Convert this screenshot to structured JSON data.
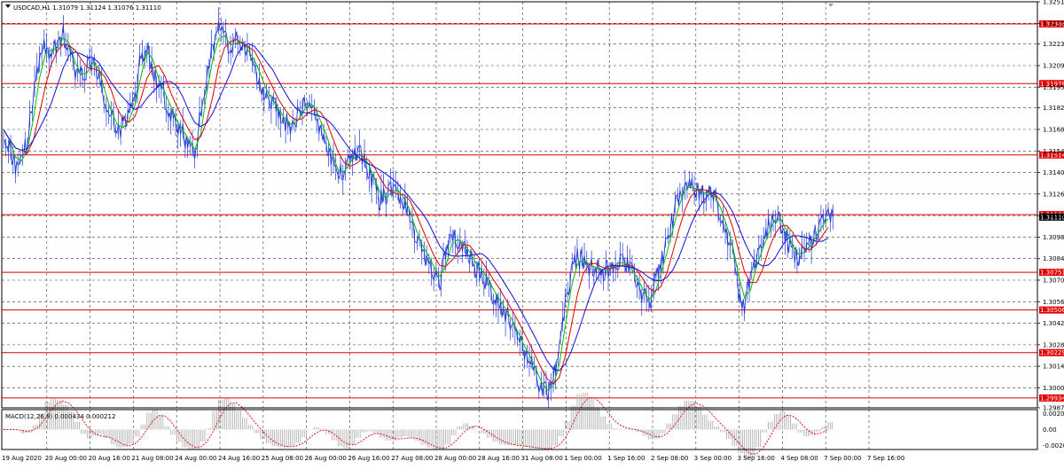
{
  "header": {
    "symbol_info": "USDCAD,H1  1.31079 1.31124 1.31076 1.31110"
  },
  "macd": {
    "label": "MACD(12,26,9) 0.000434 0.000212",
    "y_ticks": [
      "0.002087",
      "0.00",
      "-0.002052"
    ],
    "ylim": [
      -0.0026,
      0.0026
    ]
  },
  "colors": {
    "background": "#ffffff",
    "price_line": "#1f39d8",
    "ma_fast": "#00c000",
    "ma_mid": "#e00000",
    "ma_slow": "#1010e0",
    "level_line": "#e00000",
    "macd_hist": "#b0b0b0",
    "macd_signal": "#e00000"
  },
  "chart_data": {
    "type": "line",
    "ylim": [
      1.2987,
      1.3251
    ],
    "grid": true,
    "y_ticks": [
      "1.32510",
      "1.32370",
      "1.32235",
      "1.32095",
      "1.31955",
      "1.31820",
      "1.31680",
      "1.31540",
      "1.31400",
      "1.31260",
      "1.31120",
      "1.30980",
      "1.30840",
      "1.30700",
      "1.30560",
      "1.30420",
      "1.30280",
      "1.30140",
      "1.30000",
      "1.29870"
    ],
    "x_ticks": [
      "19 Aug 2020",
      "20 Aug 00:00",
      "20 Aug 16:00",
      "21 Aug 08:00",
      "24 Aug 00:00",
      "24 Aug 16:00",
      "25 Aug 08:00",
      "26 Aug 00:00",
      "26 Aug 16:00",
      "27 Aug 08:00",
      "28 Aug 00:00",
      "28 Aug 16:00",
      "31 Aug 08:00",
      "1 Sep 00:00",
      "1 Sep 16:00",
      "2 Sep 08:00",
      "3 Sep 00:00",
      "3 Sep 16:00",
      "4 Sep 08:00",
      "7 Sep 00:00",
      "7 Sep 16:00"
    ],
    "levels": [
      "1.32366",
      "1.31978",
      "1.31514",
      "1.31126",
      "1.30751",
      "1.30506",
      "1.30229",
      "1.29934"
    ],
    "current_price": "1.31110",
    "series": [
      {
        "values": [
          1.3168,
          1.3155,
          1.3145,
          1.315,
          1.316,
          1.319,
          1.3212,
          1.3222,
          1.3217,
          1.3225,
          1.323,
          1.3218,
          1.3205,
          1.3202,
          1.3208,
          1.3215,
          1.32,
          1.3185,
          1.3175,
          1.3168,
          1.317,
          1.3178,
          1.319,
          1.3215,
          1.3222,
          1.3205,
          1.3196,
          1.3188,
          1.3178,
          1.317,
          1.3165,
          1.3158,
          1.3152,
          1.3178,
          1.3205,
          1.3222,
          1.3232,
          1.3226,
          1.322,
          1.3228,
          1.3222,
          1.3216,
          1.321,
          1.3198,
          1.319,
          1.3185,
          1.3178,
          1.3173,
          1.317,
          1.3175,
          1.3182,
          1.3188,
          1.3178,
          1.317,
          1.316,
          1.3145,
          1.3138,
          1.3143,
          1.315,
          1.3152,
          1.315,
          1.3142,
          1.3132,
          1.3122,
          1.3125,
          1.313,
          1.3127,
          1.312,
          1.311,
          1.3097,
          1.309,
          1.3083,
          1.3075,
          1.307,
          1.3088,
          1.3098,
          1.3095,
          1.3092,
          1.3085,
          1.3078,
          1.3075,
          1.3068,
          1.306,
          1.3055,
          1.3048,
          1.3042,
          1.3032,
          1.3025,
          1.3018,
          1.3008,
          1.3,
          1.2997,
          1.3005,
          1.3025,
          1.3055,
          1.3075,
          1.3085,
          1.3082,
          1.3079,
          1.3078,
          1.3076,
          1.3077,
          1.3081,
          1.3082,
          1.308,
          1.3076,
          1.3068,
          1.306,
          1.3055,
          1.3068,
          1.308,
          1.3095,
          1.311,
          1.3125,
          1.3132,
          1.313,
          1.3128,
          1.3126,
          1.3128,
          1.3122,
          1.3112,
          1.31,
          1.3085,
          1.3062,
          1.3055,
          1.3072,
          1.3085,
          1.3095,
          1.3105,
          1.3112,
          1.3108,
          1.3098,
          1.3088,
          1.3086,
          1.309,
          1.3095,
          1.3102,
          1.3108,
          1.3112
        ]
      },
      {
        "name": "",
        "values": []
      },
      {
        "name": "",
        "values": []
      },
      {
        "name": "",
        "values": []
      }
    ]
  }
}
